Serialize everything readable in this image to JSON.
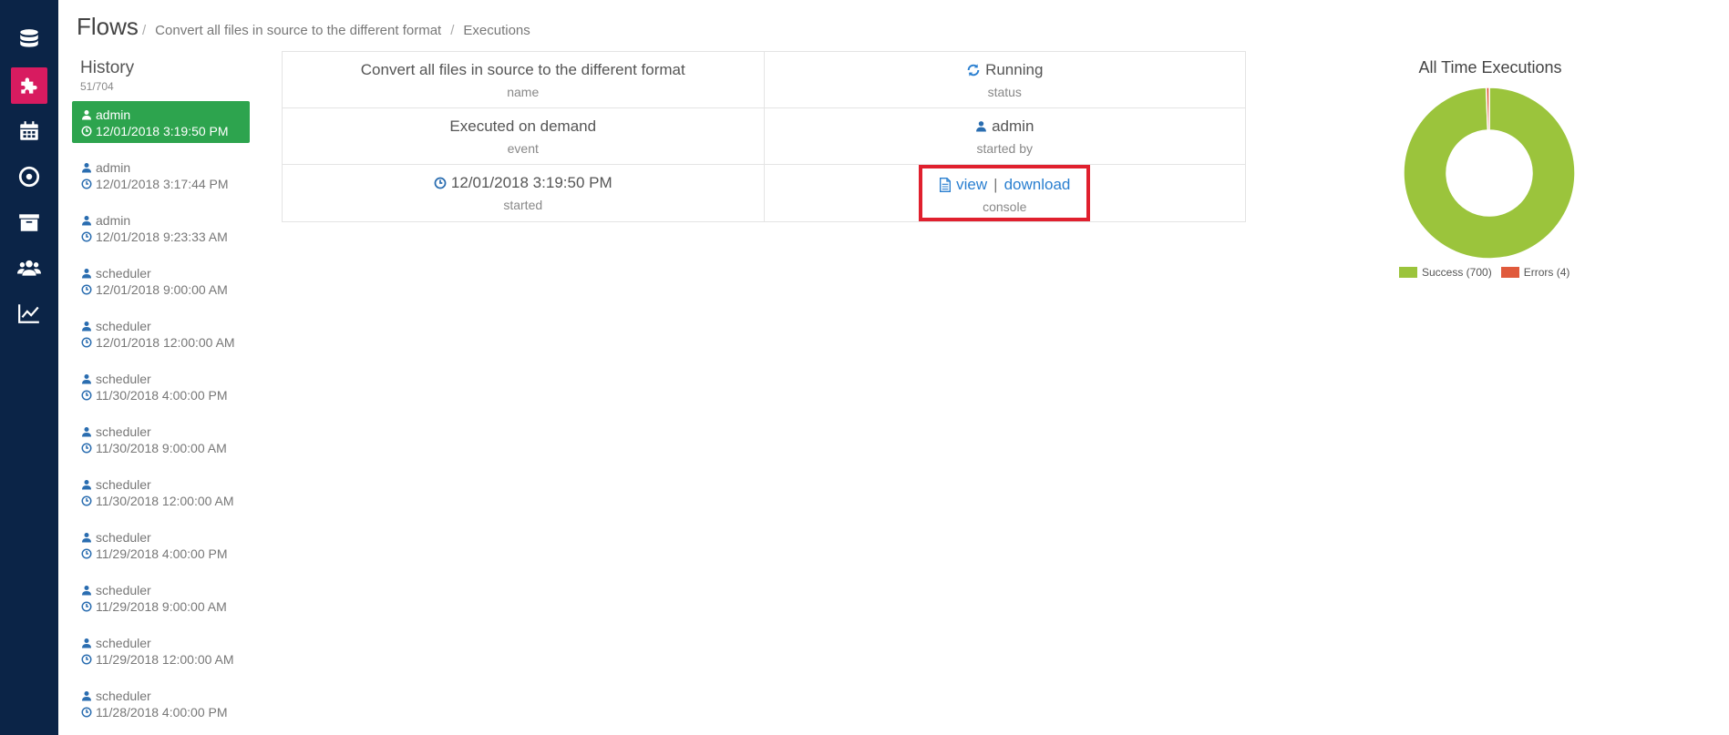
{
  "nav": {
    "items": [
      {
        "icon": "database-icon"
      },
      {
        "icon": "puzzle-icon",
        "active": true
      },
      {
        "icon": "calendar-icon"
      },
      {
        "icon": "compass-icon"
      },
      {
        "icon": "archive-icon"
      },
      {
        "icon": "users-icon"
      },
      {
        "icon": "line-chart-icon"
      }
    ],
    "colors": {
      "bg": "#0b2447",
      "active": "#d81b60"
    }
  },
  "header": {
    "title": "Flows",
    "breadcrumb": [
      "Convert all files in source to the different format",
      "Executions"
    ]
  },
  "history": {
    "title": "History",
    "count": "51/704",
    "items": [
      {
        "user": "admin",
        "time": "12/01/2018 3:19:50 PM",
        "active": true
      },
      {
        "user": "admin",
        "time": "12/01/2018 3:17:44 PM"
      },
      {
        "user": "admin",
        "time": "12/01/2018 9:23:33 AM"
      },
      {
        "user": "scheduler",
        "time": "12/01/2018 9:00:00 AM"
      },
      {
        "user": "scheduler",
        "time": "12/01/2018 12:00:00 AM"
      },
      {
        "user": "scheduler",
        "time": "11/30/2018 4:00:00 PM"
      },
      {
        "user": "scheduler",
        "time": "11/30/2018 9:00:00 AM"
      },
      {
        "user": "scheduler",
        "time": "11/30/2018 12:00:00 AM"
      },
      {
        "user": "scheduler",
        "time": "11/29/2018 4:00:00 PM"
      },
      {
        "user": "scheduler",
        "time": "11/29/2018 9:00:00 AM"
      },
      {
        "user": "scheduler",
        "time": "11/29/2018 12:00:00 AM"
      },
      {
        "user": "scheduler",
        "time": "11/28/2018 4:00:00 PM"
      }
    ]
  },
  "details": {
    "name": {
      "value": "Convert all files in source to the different format",
      "label": "name"
    },
    "status": {
      "value": "Running",
      "label": "status"
    },
    "event": {
      "value": "Executed on demand",
      "label": "event"
    },
    "started_by": {
      "value": "admin",
      "label": "started by"
    },
    "started": {
      "value": "12/01/2018 3:19:50 PM",
      "label": "started"
    },
    "console": {
      "view": "view",
      "separator": "|",
      "download": "download",
      "label": "console"
    }
  },
  "chart_data": {
    "type": "pie",
    "title": "All Time Executions",
    "categories": [
      "Success",
      "Errors"
    ],
    "values": [
      700,
      4
    ],
    "legend_labels": [
      "Success (700)",
      "Errors (4)"
    ],
    "colors": [
      "#9bc43c",
      "#e05a3c"
    ],
    "donut": true,
    "legend": "bottom"
  }
}
